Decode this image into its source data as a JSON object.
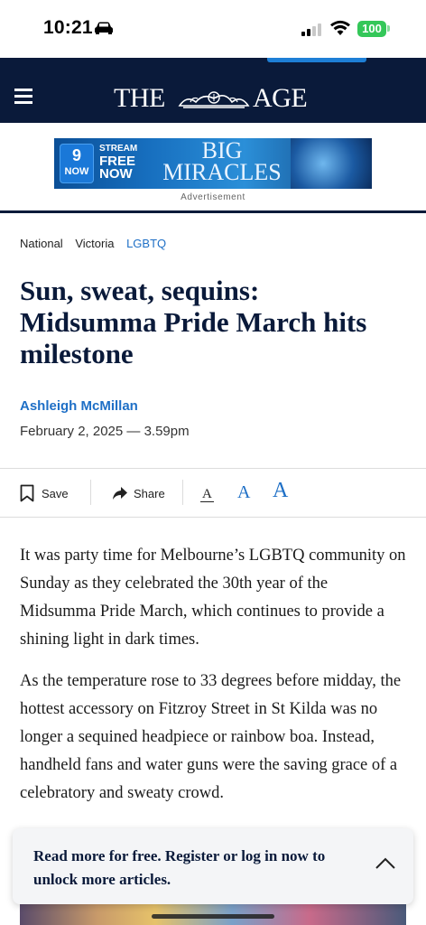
{
  "status_bar": {
    "time": "10:21",
    "battery": "100"
  },
  "masthead": {
    "logo_left": "THE",
    "logo_right": "AGE"
  },
  "ad": {
    "nine_logo": "9",
    "nine_sub": "NOW",
    "stream_line1": "STREAM",
    "stream_line2": "FREE",
    "stream_line3": "NOW",
    "title_line1": "BIG",
    "title_line2": "MIRACLES",
    "label": "Advertisement"
  },
  "breadcrumbs": [
    {
      "label": "National"
    },
    {
      "label": "Victoria"
    },
    {
      "label": "LGBTQ"
    }
  ],
  "article": {
    "headline": "Sun, sweat, sequins: Midsumma Pride March hits milestone",
    "author": "Ashleigh McMillan",
    "dateline": "February 2, 2025 — 3.59pm",
    "paragraphs": [
      "It was party time for Melbourne’s LGBTQ community on Sunday as they celebrated the 30th year of the Midsumma Pride March, which continues to provide a shining light in dark times.",
      "As the temperature rose to 33 degrees before midday, the hottest accessory on Fitzroy Street in St Kilda was no longer a sequined headpiece or rainbow boa. Instead, handheld fans and water guns were the saving grace of a celebratory and sweaty crowd."
    ]
  },
  "toolbar": {
    "save_label": "Save",
    "share_label": "Share",
    "font_small": "A",
    "font_medium": "A",
    "font_large": "A"
  },
  "register_card": {
    "text": "Read more for free. Register or log in now to unlock more articles."
  },
  "colors": {
    "navy": "#0a1a3a",
    "link_blue": "#1e6fc6",
    "battery_green": "#34c759"
  }
}
